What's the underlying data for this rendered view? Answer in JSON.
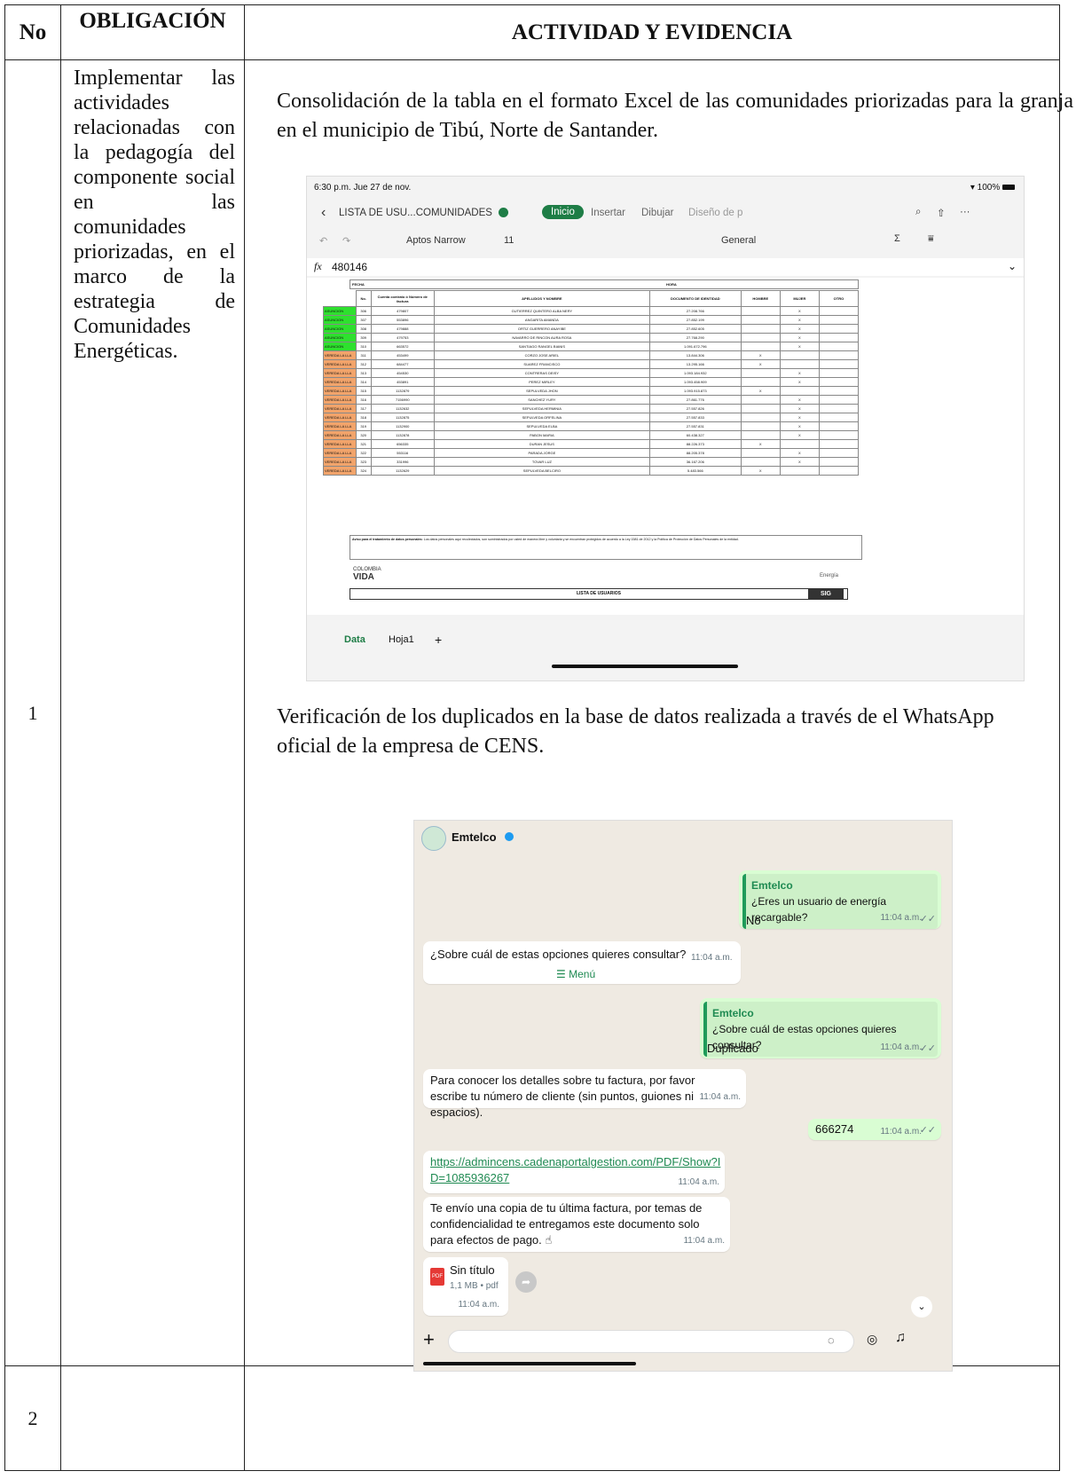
{
  "table": {
    "headers": {
      "no": "No",
      "obligacion": "OBLIGACIÓN",
      "actividad": "ACTIVIDAD Y EVIDENCIA"
    },
    "rows": [
      {
        "no": "1",
        "obligacion": "Implementar las actividades relacionadas con la pedagogía del componente social en las comunidades priorizadas, en el marco de la estrategia de Comunidades Energéticas.",
        "actividad_p1": "Consolidación de la tabla en el formato Excel de las comunidades priorizadas para la granja en el municipio de Tibú, Norte de Santander.",
        "actividad_p2": "Verificación de los duplicados en la base de datos realizada a través de el WhatsApp oficial de la empresa de CENS."
      },
      {
        "no": "2",
        "obligacion": "",
        "actividad_p1": "",
        "actividad_p2": ""
      }
    ]
  },
  "excel": {
    "status_time": "6:30 p.m.  Jue 27 de nov.",
    "battery": "100%",
    "file_title": "LISTA DE USU...COMUNIDADES",
    "menu": [
      "Inicio",
      "Insertar",
      "Dibujar",
      "Diseño de p"
    ],
    "font": "Aptos Narrow",
    "font_size": "11",
    "number_format": "General",
    "formula": "480146",
    "fx": "fx",
    "col_headers": [
      "FECHA",
      "HORA"
    ],
    "table_headers": [
      "No.",
      "Cuenta contrato ó Número de factura",
      "APELLIDOS Y NOMBRE",
      "DOCUMENTO DE IDENTIDAD",
      "SEXO",
      "HOMBRE",
      "MUJER",
      "OTRO"
    ],
    "rows": [
      {
        "grp": "ASUNCION",
        "c": "green",
        "n": "306",
        "cc": "479807",
        "name": "GUTIERREZ QUINTERO ALBA NERY",
        "doc": "27.208.766",
        "sex": "M"
      },
      {
        "grp": "ASUNCION",
        "c": "green",
        "n": "307",
        "cc": "553896",
        "name": "ANGARITA AMANDA",
        "doc": "27.852.199",
        "sex": "M"
      },
      {
        "grp": "ASUNCION",
        "c": "green",
        "n": "308",
        "cc": "479888",
        "name": "ORTIZ GUERRERO ANAYIBE",
        "doc": "27.852.605",
        "sex": "M"
      },
      {
        "grp": "ASUNCION",
        "c": "green",
        "n": "309",
        "cc": "479753",
        "name": "NAVARRO DE RINCON AURA ROSA",
        "doc": "27.768.290",
        "sex": "M"
      },
      {
        "grp": "ASUNCION",
        "c": "green",
        "n": "310",
        "cc": "663572",
        "name": "SANTIAGO RANGEL BIANIS",
        "doc": "1.091.672.796",
        "sex": "M"
      },
      {
        "grp": "VEREDA LA LLA",
        "c": "orange",
        "n": "311",
        "cc": "453499",
        "name": "CORZO JOSE ARIEL",
        "doc": "13.844.306",
        "sex": "H"
      },
      {
        "grp": "VEREDA LA LLA",
        "c": "orange",
        "n": "312",
        "cc": "684477",
        "name": "SUAREZ FRANCISCO",
        "doc": "13.295.166",
        "sex": "H"
      },
      {
        "grp": "VEREDA LA LLA",
        "c": "orange",
        "n": "313",
        "cc": "454530",
        "name": "CONTRERAS DEISY",
        "doc": "1.093.184.932",
        "sex": "M"
      },
      {
        "grp": "VEREDA LA LLA",
        "c": "orange",
        "n": "314",
        "cc": "453891",
        "name": "PEREZ MIRLEY",
        "doc": "1.093.458.909",
        "sex": "M"
      },
      {
        "grp": "VEREDA LA LLA",
        "c": "orange",
        "n": "315",
        "cc": "1132879",
        "name": "SEPULVEDA JHON",
        "doc": "1.093.915.873",
        "sex": "H"
      },
      {
        "grp": "VEREDA LA LLA",
        "c": "orange",
        "n": "316",
        "cc": "7156990",
        "name": "SANCHEZ YURY",
        "doc": "27.861.776",
        "sex": "M"
      },
      {
        "grp": "VEREDA LA LLA",
        "c": "orange",
        "n": "317",
        "cc": "1132632",
        "name": "SEPULVEDA HERMINIA",
        "doc": "27.557.826",
        "sex": "M"
      },
      {
        "grp": "VEREDA LA LLA",
        "c": "orange",
        "n": "318",
        "cc": "1132875",
        "name": "SEPULVEDA ORFELINA",
        "doc": "27.557.833",
        "sex": "M"
      },
      {
        "grp": "VEREDA LA LLA",
        "c": "orange",
        "n": "319",
        "cc": "1132900",
        "name": "SEPULVEDA ELBA",
        "doc": "27.557.831",
        "sex": "M"
      },
      {
        "grp": "VEREDA LA LLA",
        "c": "orange",
        "n": "320",
        "cc": "1132878",
        "name": "PABON MARIA",
        "doc": "60.438.327",
        "sex": "M"
      },
      {
        "grp": "VEREDA LA LLA",
        "c": "orange",
        "n": "321",
        "cc": "656335",
        "name": "DURAN JESUS",
        "doc": "88.226.373",
        "sex": "H"
      },
      {
        "grp": "VEREDA LA LLA",
        "c": "orange",
        "n": "322",
        "cc": "553116",
        "name": "PARADA JORGE",
        "doc": "88.205.378",
        "sex": "M"
      },
      {
        "grp": "VEREDA LA LLA",
        "c": "orange",
        "n": "323",
        "cc": "331996",
        "name": "TOVAR LUZ",
        "doc": "36.167.206",
        "sex": "M"
      },
      {
        "grp": "VEREDA LA LLA",
        "c": "orange",
        "n": "324",
        "cc": "1132629",
        "name": "SEPULVEDA BELCIRO",
        "doc": "5.483.566",
        "sex": "H"
      }
    ],
    "x_mark": "X",
    "aviso_title": "Aviso para el tratamiento de datos personales:",
    "aviso_text": "Los datos personales aquí recolectados, son suministrados por usted de manera libre y voluntaria y se encuentran protegidos de acuerdo a la Ley 1581 de 2012 y la Política de Protección de Datos Personales de la entidad.",
    "logo_top": "COLOMBIA",
    "logo_bottom": "VIDA",
    "energia": "Energía",
    "footer_title": "LISTA DE USUARIOS",
    "sig": "SIG",
    "sheet_tabs": [
      "Data",
      "Hoja1",
      "+"
    ]
  },
  "whatsapp": {
    "contact": "Emtelco",
    "messages": {
      "q1_name": "Emtelco",
      "q1_text": "¿Eres un usuario de energía recargable?",
      "a1": "No",
      "t1": "11:04 a.m.",
      "m2": "¿Sobre cuál de estas opciones quieres consultar?",
      "t2": "11:04 a.m.",
      "menu": "Menú",
      "q2_name": "Emtelco",
      "q2_text": "¿Sobre cuál de estas opciones quieres consultar?",
      "a2": "Duplicado",
      "t3": "11:04 a.m.",
      "m3": "Para conocer los detalles sobre tu factura, por favor escribe tu número de cliente (sin puntos, guiones ni espacios).",
      "t4": "11:04 a.m.",
      "a3": "666274",
      "t5": "11:04 a.m.",
      "link": "https://admincens.cadenaportalgestion.com/PDF/Show?ID=1085936267",
      "t6": "11:04 a.m.",
      "m4": "Te envío una copia de tu última factura, por temas de confidencialidad te entregamos este documento solo para efectos de pago. ☝",
      "t7": "11:04 a.m.",
      "file_name": "Sin título",
      "file_meta": "1,1 MB • pdf",
      "file_badge": "PDF",
      "t8": "11:04 a.m."
    }
  }
}
